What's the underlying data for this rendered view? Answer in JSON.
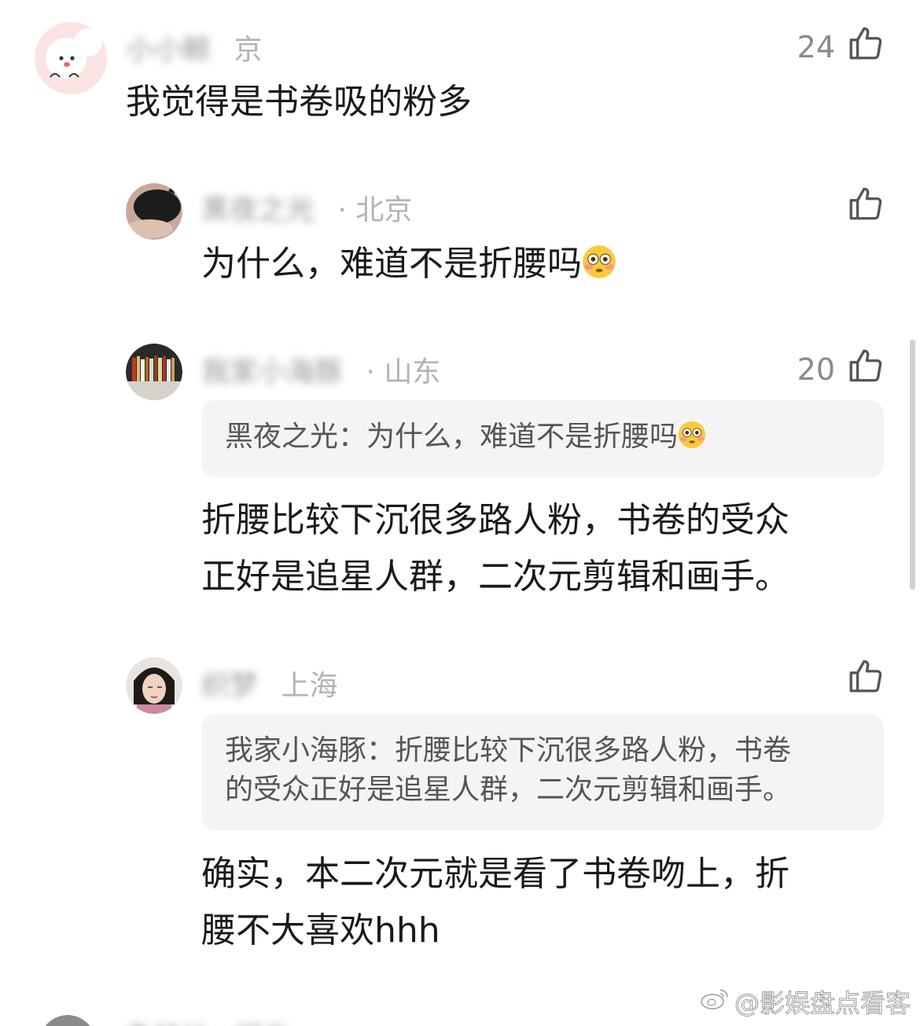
{
  "comments": [
    {
      "username": "小小鲸",
      "location": "京",
      "likes": "24",
      "text": "我觉得是书卷吸的粉多"
    },
    {
      "username": "黑夜之光",
      "location": "· 北京",
      "likes": "",
      "text": "为什么，难道不是折腰吗"
    },
    {
      "username": "我家小海豚",
      "location": "· 山东",
      "likes": "20",
      "quote": "黑夜之光：为什么，难道不是折腰吗",
      "text_line1": "折腰比较下沉很多路人粉，书卷的受众",
      "text_line2": "正好是追星人群，二次元剪辑和画手。"
    },
    {
      "username": "织梦",
      "location": "上海",
      "likes": "",
      "quote_line1": "我家小海豚：折腰比较下沉很多路人粉，书卷",
      "quote_line2": "的受众正好是追星人群，二次元剪辑和画手。",
      "text_line1": "确实，本二次元就是看了书卷吻上，折",
      "text_line2": "腰不大喜欢hhh"
    },
    {
      "username": "鱼味汁",
      "location": "河北"
    }
  ],
  "watermark": "@影娱盘点看客",
  "icons": {
    "like": "thumbs-up-icon",
    "emoji": "flushed-face-emoji"
  },
  "colors": {
    "meta": "#b3b3b3",
    "quote_bg": "#f4f4f4",
    "text": "#1a1a1a"
  }
}
